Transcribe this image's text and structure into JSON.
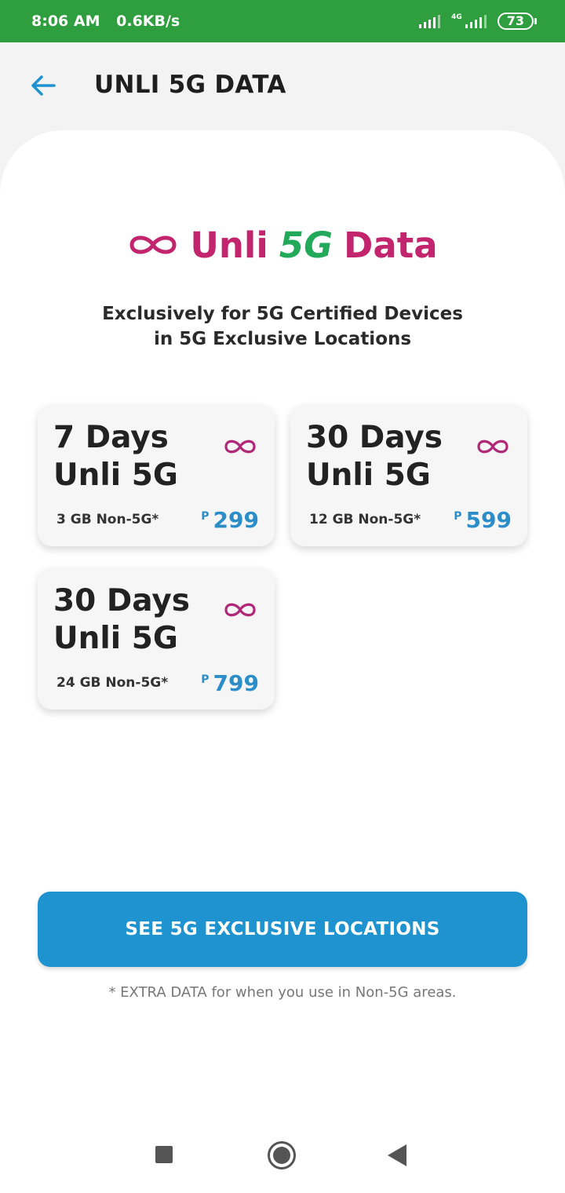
{
  "status_bar": {
    "time": "8:06 AM",
    "speed": "0.6KB/s",
    "network": "4G",
    "battery": "73"
  },
  "header": {
    "title": "UNLI 5G DATA",
    "back_icon": "arrow-left-icon"
  },
  "brand": {
    "word1": "Unli",
    "word2": "5G",
    "word3": "Data",
    "icon": "infinity-icon"
  },
  "tagline": {
    "line1": "Exclusively for 5G Certified Devices",
    "line2": "in 5G Exclusive Locations"
  },
  "plans": [
    {
      "line1": "7 Days",
      "line2": "Unli 5G",
      "allowance": "3 GB Non-5G*",
      "currency": "P",
      "price": "299"
    },
    {
      "line1": "30 Days",
      "line2": "Unli 5G",
      "allowance": "12 GB Non-5G*",
      "currency": "P",
      "price": "599"
    },
    {
      "line1": "30 Days",
      "line2": "Unli 5G",
      "allowance": "24 GB Non-5G*",
      "currency": "P",
      "price": "799"
    }
  ],
  "cta": {
    "label": "SEE 5G EXCLUSIVE LOCATIONS"
  },
  "footnote": "* EXTRA DATA for when you use in Non-5G areas.",
  "colors": {
    "status_bar": "#2e9e3f",
    "accent_blue": "#1e93cf",
    "brand_magenta": "#c2246d",
    "brand_green": "#23a95a"
  },
  "nav": {
    "recents_icon": "square-recents-icon",
    "home_icon": "circle-home-icon",
    "back_icon": "triangle-back-icon"
  }
}
